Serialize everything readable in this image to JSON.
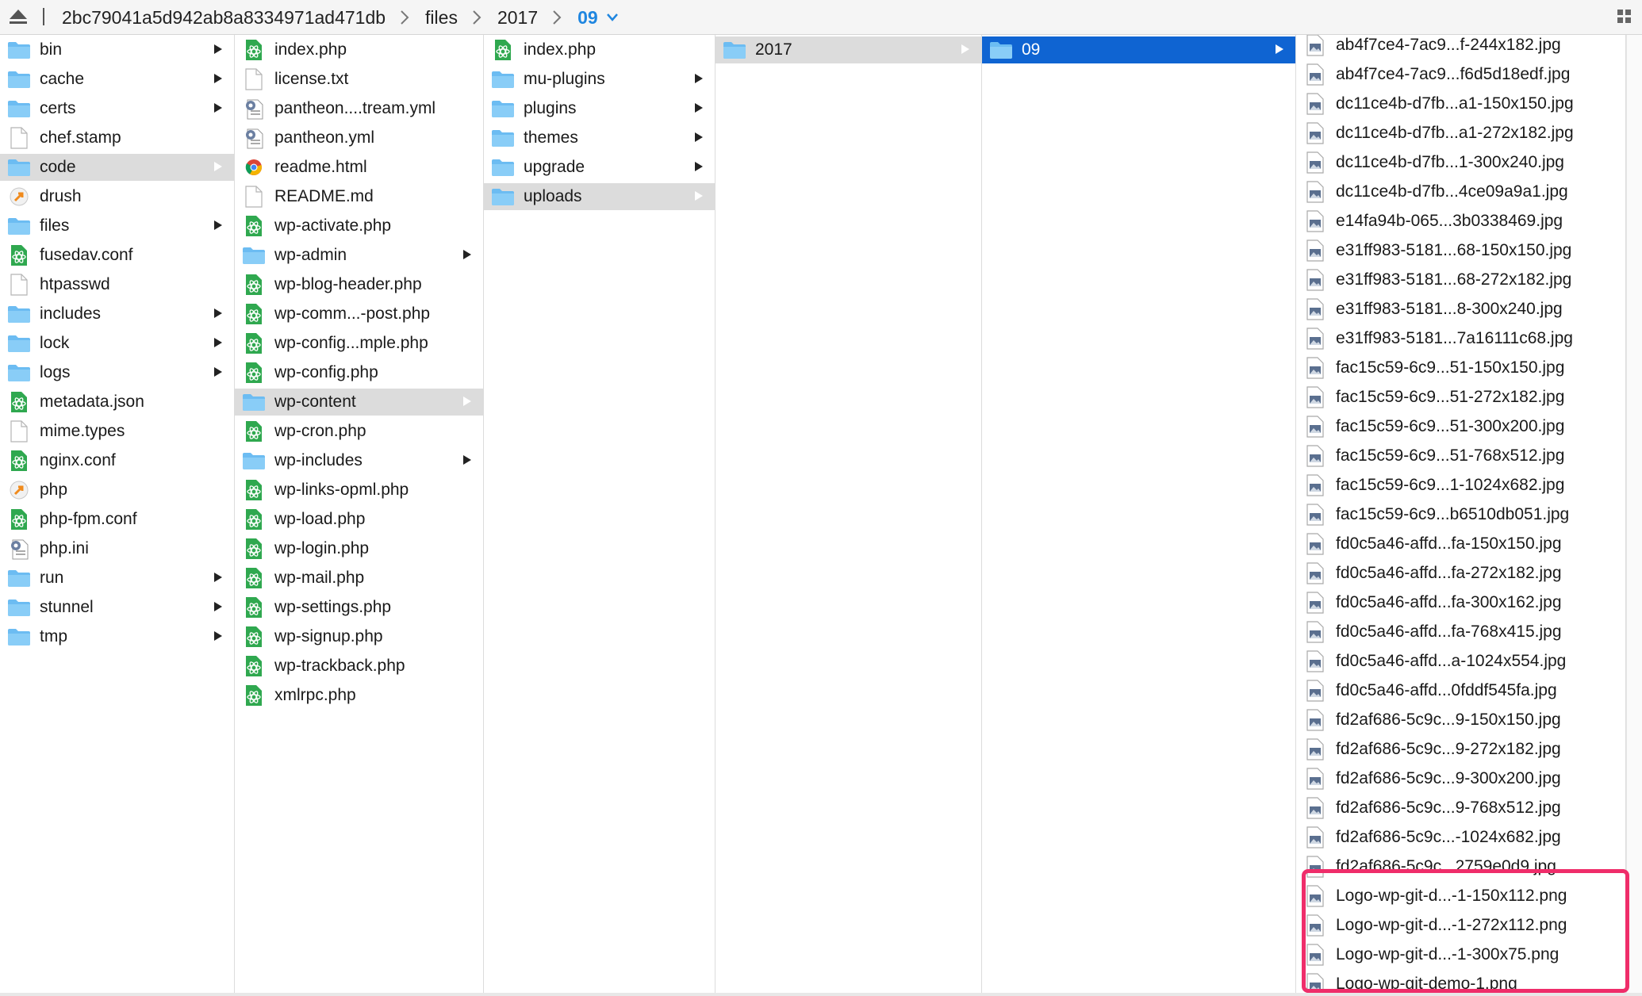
{
  "pathbar": {
    "crumbs": [
      "2bc79041a5d942ab8a8334971ad471db",
      "files",
      "2017"
    ],
    "current": "09"
  },
  "columns": [
    {
      "items": [
        {
          "label": "bin",
          "icon": "folder",
          "arrow": true
        },
        {
          "label": "cache",
          "icon": "folder",
          "arrow": true
        },
        {
          "label": "certs",
          "icon": "folder",
          "arrow": true
        },
        {
          "label": "chef.stamp",
          "icon": "file",
          "arrow": false
        },
        {
          "label": "code",
          "icon": "folder",
          "arrow": true,
          "selected": "gray"
        },
        {
          "label": "drush",
          "icon": "script",
          "arrow": false
        },
        {
          "label": "files",
          "icon": "folder",
          "arrow": true
        },
        {
          "label": "fusedav.conf",
          "icon": "atom",
          "arrow": false
        },
        {
          "label": "htpasswd",
          "icon": "file",
          "arrow": false
        },
        {
          "label": "includes",
          "icon": "folder",
          "arrow": true
        },
        {
          "label": "lock",
          "icon": "folder",
          "arrow": true
        },
        {
          "label": "logs",
          "icon": "folder",
          "arrow": true
        },
        {
          "label": "metadata.json",
          "icon": "atom",
          "arrow": false
        },
        {
          "label": "mime.types",
          "icon": "file",
          "arrow": false
        },
        {
          "label": "nginx.conf",
          "icon": "atom",
          "arrow": false
        },
        {
          "label": "php",
          "icon": "script",
          "arrow": false
        },
        {
          "label": "php-fpm.conf",
          "icon": "atom",
          "arrow": false
        },
        {
          "label": "php.ini",
          "icon": "config",
          "arrow": false
        },
        {
          "label": "run",
          "icon": "folder",
          "arrow": true
        },
        {
          "label": "stunnel",
          "icon": "folder",
          "arrow": true
        },
        {
          "label": "tmp",
          "icon": "folder",
          "arrow": true
        }
      ]
    },
    {
      "items": [
        {
          "label": "index.php",
          "icon": "atom",
          "arrow": false
        },
        {
          "label": "license.txt",
          "icon": "file",
          "arrow": false
        },
        {
          "label": "pantheon....tream.yml",
          "icon": "config",
          "arrow": false
        },
        {
          "label": "pantheon.yml",
          "icon": "config",
          "arrow": false
        },
        {
          "label": "readme.html",
          "icon": "chrome",
          "arrow": false
        },
        {
          "label": "README.md",
          "icon": "file",
          "arrow": false
        },
        {
          "label": "wp-activate.php",
          "icon": "atom",
          "arrow": false
        },
        {
          "label": "wp-admin",
          "icon": "folder",
          "arrow": true
        },
        {
          "label": "wp-blog-header.php",
          "icon": "atom",
          "arrow": false
        },
        {
          "label": "wp-comm...-post.php",
          "icon": "atom",
          "arrow": false
        },
        {
          "label": "wp-config...mple.php",
          "icon": "atom",
          "arrow": false
        },
        {
          "label": "wp-config.php",
          "icon": "atom",
          "arrow": false
        },
        {
          "label": "wp-content",
          "icon": "folder",
          "arrow": true,
          "selected": "gray"
        },
        {
          "label": "wp-cron.php",
          "icon": "atom",
          "arrow": false
        },
        {
          "label": "wp-includes",
          "icon": "folder",
          "arrow": true
        },
        {
          "label": "wp-links-opml.php",
          "icon": "atom",
          "arrow": false
        },
        {
          "label": "wp-load.php",
          "icon": "atom",
          "arrow": false
        },
        {
          "label": "wp-login.php",
          "icon": "atom",
          "arrow": false
        },
        {
          "label": "wp-mail.php",
          "icon": "atom",
          "arrow": false
        },
        {
          "label": "wp-settings.php",
          "icon": "atom",
          "arrow": false
        },
        {
          "label": "wp-signup.php",
          "icon": "atom",
          "arrow": false
        },
        {
          "label": "wp-trackback.php",
          "icon": "atom",
          "arrow": false
        },
        {
          "label": "xmlrpc.php",
          "icon": "atom",
          "arrow": false
        }
      ]
    },
    {
      "items": [
        {
          "label": "index.php",
          "icon": "atom",
          "arrow": false
        },
        {
          "label": "mu-plugins",
          "icon": "folder",
          "arrow": true
        },
        {
          "label": "plugins",
          "icon": "folder",
          "arrow": true
        },
        {
          "label": "themes",
          "icon": "folder",
          "arrow": true
        },
        {
          "label": "upgrade",
          "icon": "folder",
          "arrow": true
        },
        {
          "label": "uploads",
          "icon": "folder",
          "arrow": true,
          "selected": "gray"
        }
      ]
    },
    {
      "items": [
        {
          "label": "2017",
          "icon": "folder",
          "arrow": true,
          "selected": "gray"
        }
      ]
    },
    {
      "items": [
        {
          "label": "09",
          "icon": "folder",
          "arrow": true,
          "selected": "blue"
        }
      ]
    },
    {
      "items": [
        {
          "label": "ab4f7ce4-7ac9...f-244x182.jpg",
          "icon": "image",
          "arrow": false
        },
        {
          "label": "ab4f7ce4-7ac9...f6d5d18edf.jpg",
          "icon": "image",
          "arrow": false
        },
        {
          "label": "dc11ce4b-d7fb...a1-150x150.jpg",
          "icon": "image",
          "arrow": false
        },
        {
          "label": "dc11ce4b-d7fb...a1-272x182.jpg",
          "icon": "image",
          "arrow": false
        },
        {
          "label": "dc11ce4b-d7fb...1-300x240.jpg",
          "icon": "image",
          "arrow": false
        },
        {
          "label": "dc11ce4b-d7fb...4ce09a9a1.jpg",
          "icon": "image",
          "arrow": false
        },
        {
          "label": "e14fa94b-065...3b0338469.jpg",
          "icon": "image",
          "arrow": false
        },
        {
          "label": "e31ff983-5181...68-150x150.jpg",
          "icon": "image",
          "arrow": false
        },
        {
          "label": "e31ff983-5181...68-272x182.jpg",
          "icon": "image",
          "arrow": false
        },
        {
          "label": "e31ff983-5181...8-300x240.jpg",
          "icon": "image",
          "arrow": false
        },
        {
          "label": "e31ff983-5181...7a16111c68.jpg",
          "icon": "image",
          "arrow": false
        },
        {
          "label": "fac15c59-6c9...51-150x150.jpg",
          "icon": "image",
          "arrow": false
        },
        {
          "label": "fac15c59-6c9...51-272x182.jpg",
          "icon": "image",
          "arrow": false
        },
        {
          "label": "fac15c59-6c9...51-300x200.jpg",
          "icon": "image",
          "arrow": false
        },
        {
          "label": "fac15c59-6c9...51-768x512.jpg",
          "icon": "image",
          "arrow": false
        },
        {
          "label": "fac15c59-6c9...1-1024x682.jpg",
          "icon": "image",
          "arrow": false
        },
        {
          "label": "fac15c59-6c9...b6510db051.jpg",
          "icon": "image",
          "arrow": false
        },
        {
          "label": "fd0c5a46-affd...fa-150x150.jpg",
          "icon": "image",
          "arrow": false
        },
        {
          "label": "fd0c5a46-affd...fa-272x182.jpg",
          "icon": "image",
          "arrow": false
        },
        {
          "label": "fd0c5a46-affd...fa-300x162.jpg",
          "icon": "image",
          "arrow": false
        },
        {
          "label": "fd0c5a46-affd...fa-768x415.jpg",
          "icon": "image",
          "arrow": false
        },
        {
          "label": "fd0c5a46-affd...a-1024x554.jpg",
          "icon": "image",
          "arrow": false
        },
        {
          "label": "fd0c5a46-affd...0fddf545fa.jpg",
          "icon": "image",
          "arrow": false
        },
        {
          "label": "fd2af686-5c9c...9-150x150.jpg",
          "icon": "image",
          "arrow": false
        },
        {
          "label": "fd2af686-5c9c...9-272x182.jpg",
          "icon": "image",
          "arrow": false
        },
        {
          "label": "fd2af686-5c9c...9-300x200.jpg",
          "icon": "image",
          "arrow": false
        },
        {
          "label": "fd2af686-5c9c...9-768x512.jpg",
          "icon": "image",
          "arrow": false
        },
        {
          "label": "fd2af686-5c9c...-1024x682.jpg",
          "icon": "image",
          "arrow": false
        },
        {
          "label": "fd2af686-5c9c...2759e0d9.jpg",
          "icon": "image",
          "arrow": false
        },
        {
          "label": "Logo-wp-git-d...-1-150x112.png",
          "icon": "image",
          "arrow": false
        },
        {
          "label": "Logo-wp-git-d...-1-272x112.png",
          "icon": "image",
          "arrow": false
        },
        {
          "label": "Logo-wp-git-d...-1-300x75.png",
          "icon": "image",
          "arrow": false
        },
        {
          "label": "Logo-wp-git-demo-1.png",
          "icon": "image",
          "arrow": false
        }
      ]
    }
  ],
  "colors": {
    "accent": "#1f86e0",
    "selection_blue": "#0f64d2",
    "selection_gray": "#dcdcdc",
    "folder": "#6cbcf2",
    "highlight": "#ef2d6a"
  }
}
